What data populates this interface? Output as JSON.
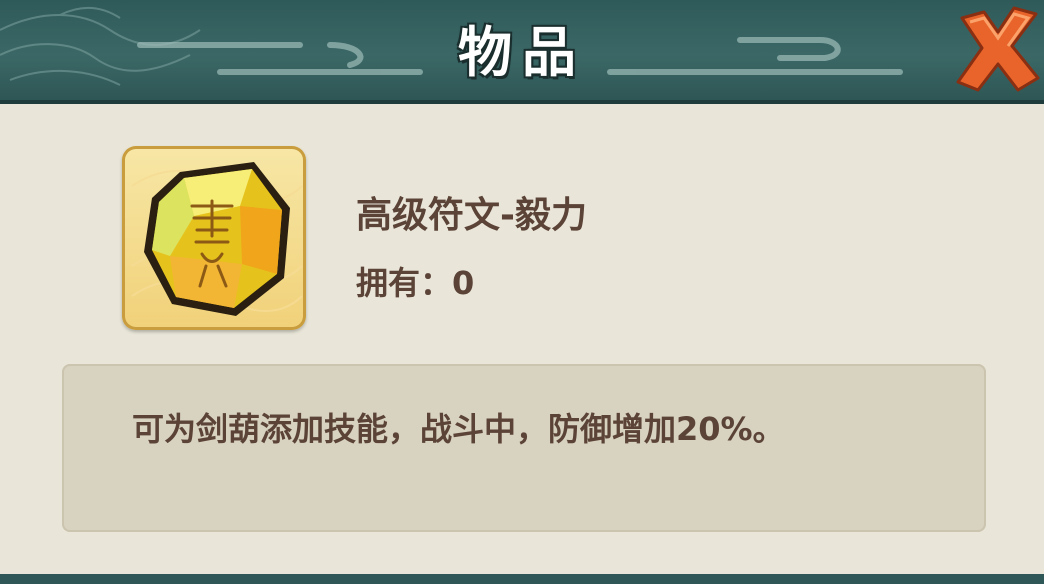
{
  "window": {
    "title": "物品"
  },
  "item": {
    "name": "高级符文-毅力",
    "owned_label": "拥有：",
    "owned_count": "0",
    "description": "可为剑葫添加技能，战斗中，防御增加20%。",
    "icon": "rune-stone-icon"
  },
  "close": {
    "icon": "close-x-icon"
  },
  "colors": {
    "header": "#3b6866",
    "panel": "#e9e6d9",
    "text": "#5b4337",
    "desc_box": "#d8d2c0",
    "close_x": "#e8642a"
  }
}
